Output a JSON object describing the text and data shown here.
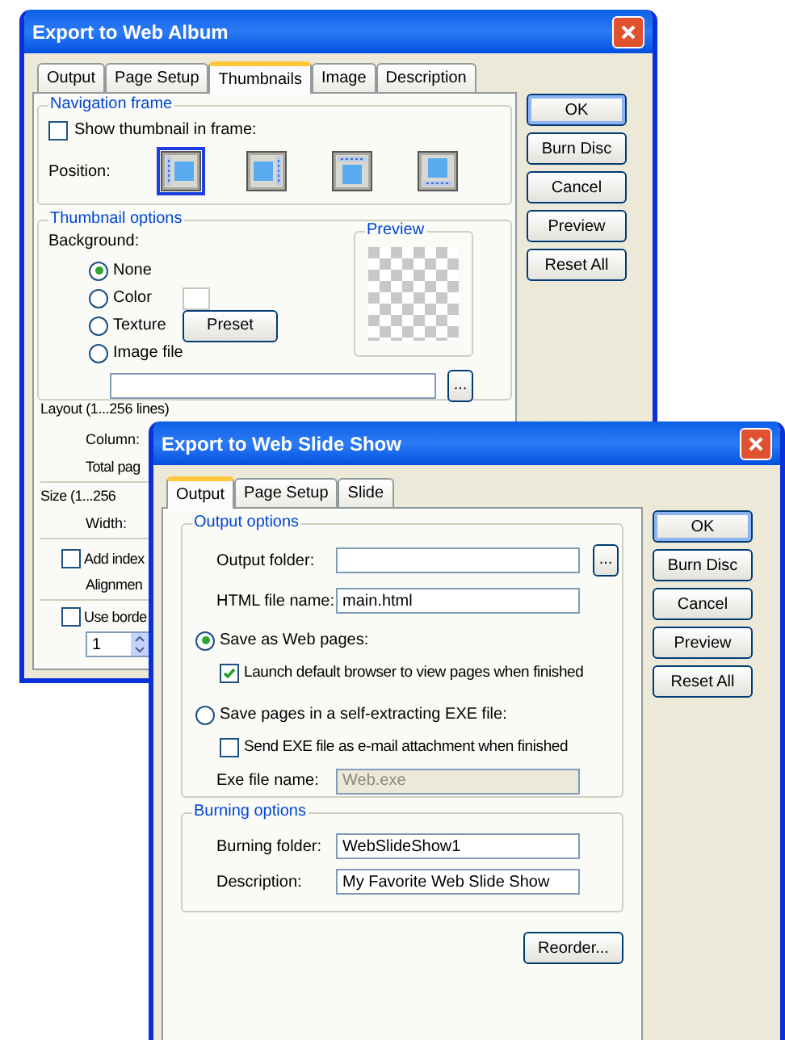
{
  "album_window": {
    "title": "Export to Web Album",
    "tabs": [
      {
        "label": "Output",
        "selected": false
      },
      {
        "label": "Page Setup",
        "selected": false
      },
      {
        "label": "Thumbnails",
        "selected": true
      },
      {
        "label": "Image",
        "selected": false
      },
      {
        "label": "Description",
        "selected": false
      }
    ],
    "navigation_frame": {
      "legend": "Navigation frame",
      "show_thumbnail": {
        "label": "Show thumbnail in frame:",
        "checked": false
      },
      "position_label": "Position:",
      "positions": [
        {
          "kind": "left",
          "selected": true
        },
        {
          "kind": "right",
          "selected": false
        },
        {
          "kind": "top",
          "selected": false
        },
        {
          "kind": "bottom",
          "selected": false
        }
      ]
    },
    "thumbnail_options": {
      "legend": "Thumbnail options",
      "background_label": "Background:",
      "backgrounds": [
        {
          "label": "None",
          "selected": true
        },
        {
          "label": "Color",
          "selected": false
        },
        {
          "label": "Texture",
          "selected": false
        },
        {
          "label": "Image file",
          "selected": false
        }
      ],
      "preset_button": "Preset",
      "preview_legend": "Preview",
      "browse_button": "..."
    },
    "layout_label": "Layout (1...256 lines)",
    "column_label": "Column:",
    "total_label": "Total pag",
    "size_label": "Size (1...256",
    "width_label": "Width:",
    "add_index": {
      "label": "Add index",
      "checked": false
    },
    "alignment_label": "Alignmen",
    "use_border": {
      "label": "Use borde",
      "checked": false
    },
    "border_value": "1",
    "buttons": [
      "OK",
      "Burn Disc",
      "Cancel",
      "Preview",
      "Reset All"
    ]
  },
  "slideshow_window": {
    "title": "Export to Web Slide Show",
    "tabs": [
      {
        "label": "Output",
        "selected": true
      },
      {
        "label": "Page Setup",
        "selected": false
      },
      {
        "label": "Slide",
        "selected": false
      }
    ],
    "output_options": {
      "legend": "Output options",
      "output_folder_label": "Output folder:",
      "browse_button": "...",
      "html_file": {
        "label": "HTML file name:",
        "value": "main.html"
      },
      "save_modes": [
        {
          "label": "Save as Web pages:",
          "selected": true,
          "option": {
            "label": "Launch default browser to view pages when finished",
            "checked": true
          }
        },
        {
          "label": "Save pages in a self-extracting EXE file:",
          "selected": false,
          "option": {
            "label": "Send EXE file as e-mail attachment when finished",
            "checked": false
          }
        }
      ],
      "exe_file": {
        "label": "Exe file name:",
        "value": "Web.exe",
        "disabled": true
      }
    },
    "burning_options": {
      "legend": "Burning options",
      "fields": [
        {
          "label": "Burning folder:",
          "value": "WebSlideShow1"
        },
        {
          "label": "Description:",
          "value": "My Favorite Web Slide Show"
        }
      ]
    },
    "reorder_button": "Reorder...",
    "buttons": [
      "OK",
      "Burn Disc",
      "Cancel",
      "Preview",
      "Reset All"
    ]
  }
}
